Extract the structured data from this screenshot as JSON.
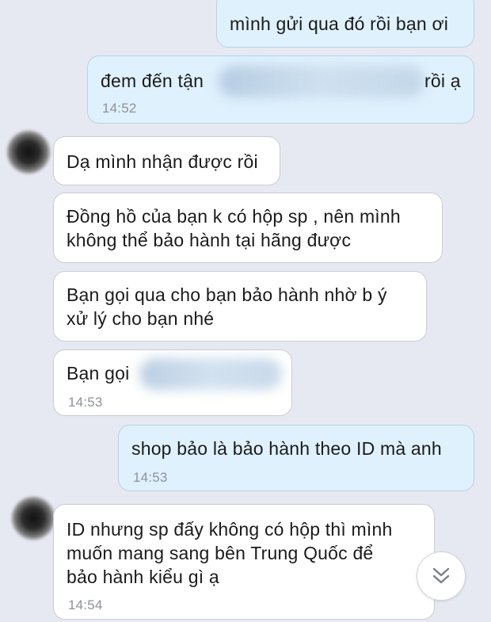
{
  "messages": [
    {
      "side": "out",
      "text": "mình gửi qua đó rồi bạn ơi",
      "time": ""
    },
    {
      "side": "out",
      "text_before": "đem đến tận",
      "text_after": "rồi ạ",
      "time": "14:52"
    },
    {
      "side": "in",
      "text": "Dạ mình nhận được rồi",
      "time": ""
    },
    {
      "side": "in",
      "lines": [
        "Đồng hồ của bạn k có hộp sp , nên mình",
        "không thể bảo hành tại hãng được"
      ],
      "time": ""
    },
    {
      "side": "in",
      "lines": [
        "Bạn gọi qua cho bạn bảo hành nhờ b ý",
        "xử lý cho bạn nhé"
      ],
      "time": ""
    },
    {
      "side": "in",
      "text": "Bạn gọi",
      "time": "14:53"
    },
    {
      "side": "out",
      "text": "shop bảo là bảo hành theo ID mà anh",
      "time": "14:53"
    },
    {
      "side": "in",
      "lines": [
        "ID nhưng sp đấy không có hộp thì mình",
        "muốn mang sang bên Trung Quốc để",
        "bảo hành kiểu gì ạ"
      ],
      "time": "14:54"
    }
  ],
  "colors": {
    "background": "#e7e9f2",
    "outgoing_bubble": "#dff1fd",
    "incoming_bubble": "#ffffff",
    "timestamp": "#8e9299"
  },
  "icons": {
    "scroll_down": "double-chevron-down-icon",
    "avatar": "avatar"
  }
}
